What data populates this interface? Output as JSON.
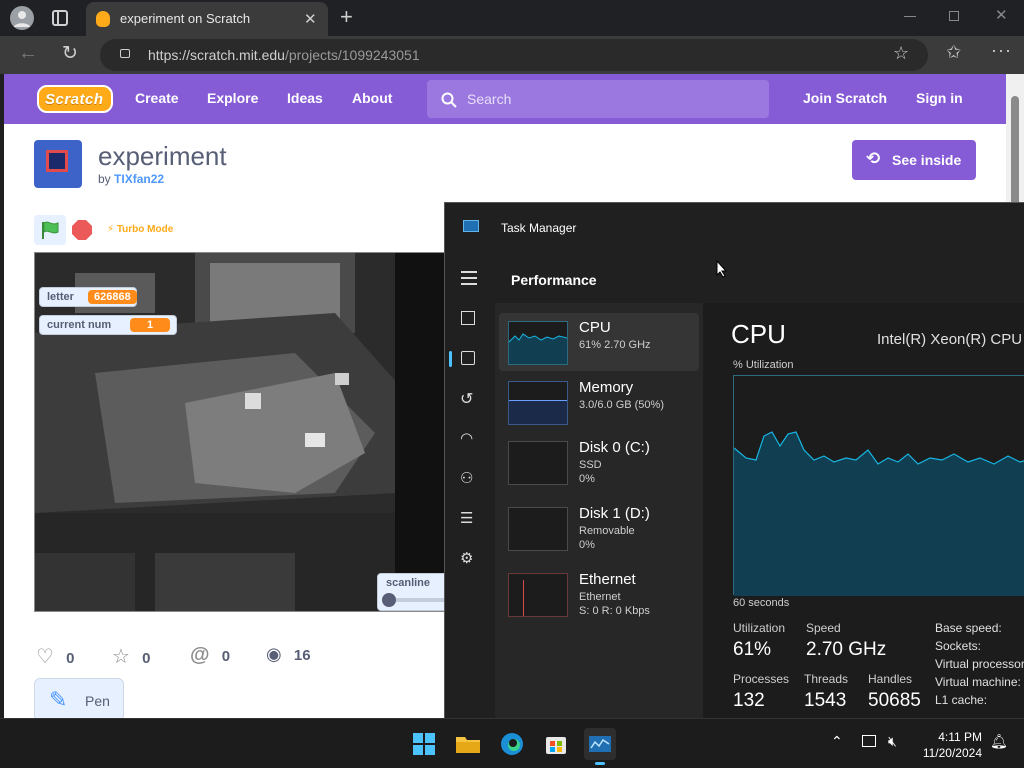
{
  "browser": {
    "tab_title": "experiment on Scratch",
    "url_host": "https://scratch.mit.edu",
    "url_path": "/projects/1099243051"
  },
  "scratch": {
    "nav": {
      "logo": "Scratch",
      "items": [
        "Create",
        "Explore",
        "Ideas",
        "About"
      ],
      "search_placeholder": "Search",
      "join": "Join Scratch",
      "signin": "Sign in"
    },
    "project": {
      "title": "experiment",
      "by_prefix": "by",
      "author": "TIXfan22",
      "see_inside": "See inside",
      "turbo": "Turbo Mode"
    },
    "monitors": [
      {
        "label": "letter",
        "value": "626868"
      },
      {
        "label": "current num",
        "value": "1"
      }
    ],
    "slider": {
      "label": "scanline",
      "level": 0
    },
    "stats": {
      "loves": "0",
      "favorites": "0",
      "remixes": "0",
      "views": "16"
    },
    "extension": "Pen"
  },
  "task_manager": {
    "title": "Task Manager",
    "section": "Performance",
    "resources": [
      {
        "name": "CPU",
        "sub1": "61%  2.70 GHz",
        "sub2": ""
      },
      {
        "name": "Memory",
        "sub1": "3.0/6.0 GB (50%)",
        "sub2": ""
      },
      {
        "name": "Disk 0 (C:)",
        "sub1": "SSD",
        "sub2": "0%"
      },
      {
        "name": "Disk 1 (D:)",
        "sub1": "Removable",
        "sub2": "0%"
      },
      {
        "name": "Ethernet",
        "sub1": "Ethernet",
        "sub2": "S: 0  R: 0 Kbps"
      }
    ],
    "cpu": {
      "heading": "CPU",
      "model": "Intel(R) Xeon(R) CPU",
      "util_label": "% Utilization",
      "time_label": "60 seconds",
      "utilization_label": "Utilization",
      "utilization": "61%",
      "speed_label": "Speed",
      "speed": "2.70 GHz",
      "processes_label": "Processes",
      "processes": "132",
      "threads_label": "Threads",
      "threads": "1543",
      "handles_label": "Handles",
      "handles": "50685",
      "specs": [
        "Base speed:",
        "Sockets:",
        "Virtual processors:",
        "Virtual machine:",
        "L1 cache:"
      ]
    }
  },
  "taskbar": {
    "time": "4:11 PM",
    "date": "11/20/2024"
  },
  "colors": {
    "scratch_purple": "#855cd6",
    "scratch_orange": "#ff8c1a",
    "tm_graph": "#17b7e3"
  }
}
